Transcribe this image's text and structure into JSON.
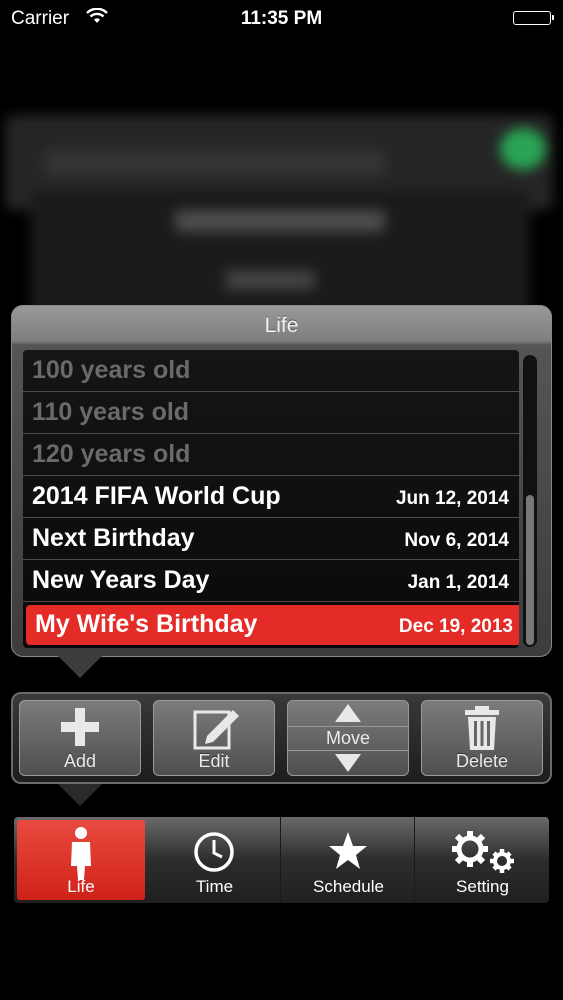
{
  "status_bar": {
    "carrier": "Carrier",
    "time": "11:35 PM"
  },
  "picker": {
    "title": "Life",
    "rows": [
      {
        "name": "100 years old",
        "date": "",
        "state": "faded"
      },
      {
        "name": "110 years old",
        "date": "",
        "state": "faded"
      },
      {
        "name": "120 years old",
        "date": "",
        "state": "faded"
      },
      {
        "name": "2014 FIFA World Cup",
        "date": "Jun 12, 2014",
        "state": "normal"
      },
      {
        "name": "Next Birthday",
        "date": "Nov 6, 2014",
        "state": "normal"
      },
      {
        "name": "New Years Day",
        "date": "Jan 1, 2014",
        "state": "normal"
      },
      {
        "name": "My Wife's Birthday",
        "date": "Dec 19, 2013",
        "state": "selected"
      }
    ]
  },
  "actions": {
    "add": "Add",
    "edit": "Edit",
    "move": "Move",
    "delete": "Delete"
  },
  "tabs": {
    "life": "Life",
    "time": "Time",
    "schedule": "Schedule",
    "setting": "Setting"
  },
  "colors": {
    "accent": "#e42b27",
    "background": "#000000"
  }
}
